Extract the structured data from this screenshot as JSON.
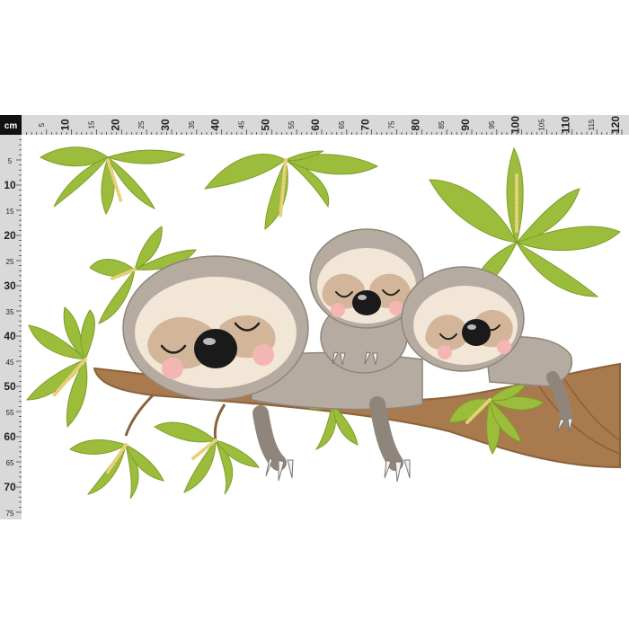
{
  "ruler": {
    "unit": "cm",
    "horizontal_labels": [
      "5",
      "10",
      "15",
      "20",
      "25",
      "30",
      "35",
      "40",
      "45",
      "50",
      "55",
      "60",
      "65",
      "70",
      "75",
      "80",
      "85",
      "90",
      "95",
      "100",
      "105",
      "110",
      "115",
      "120"
    ],
    "vertical_labels": [
      "5",
      "10",
      "15",
      "20",
      "25",
      "30",
      "35",
      "40",
      "45",
      "50",
      "55",
      "60",
      "65",
      "70",
      "75"
    ],
    "major_every": 10,
    "ruler_color": "#d9d9d9",
    "corner_color": "#111111"
  },
  "illustration": {
    "subjects": [
      "sloth-parent",
      "sloth-baby-top",
      "sloth-baby-side"
    ],
    "palette": {
      "fur": "#b5aba0",
      "fur_dark": "#8f857a",
      "face": "#f2e6d6",
      "mask": "#d3b59a",
      "cheek": "#f4b6b3",
      "nose": "#1a1a1a",
      "leaf": "#9cbc3b",
      "leaf_dark": "#7f9e2a",
      "branch": "#a87a4e",
      "branch_dark": "#8b6239",
      "flower": "#e8cf7a"
    }
  }
}
